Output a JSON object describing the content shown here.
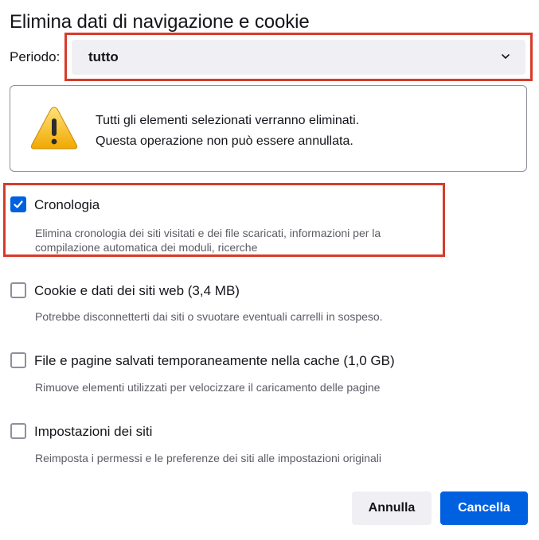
{
  "dialog": {
    "title": "Elimina dati di navigazione e cookie"
  },
  "period": {
    "label": "Periodo:",
    "value": "tutto"
  },
  "warning": {
    "line1": "Tutti gli elementi selezionati verranno eliminati.",
    "line2": "Questa operazione non può essere annullata."
  },
  "options": [
    {
      "label": "Cronologia",
      "checked": true,
      "desc1": "Elimina cronologia dei siti visitati e dei file scaricati, informazioni per la",
      "desc2": "compilazione automatica dei moduli, ricerche"
    },
    {
      "label": "Cookie e dati dei siti web (3,4 MB)",
      "checked": false,
      "desc1": "Potrebbe disconnetterti dai siti o svuotare eventuali carrelli in sospeso."
    },
    {
      "label": "File e pagine salvati temporaneamente nella cache (1,0 GB)",
      "checked": false,
      "desc1": "Rimuove elementi utilizzati per velocizzare il caricamento delle pagine"
    },
    {
      "label": "Impostazioni dei siti",
      "checked": false,
      "desc1": "Reimposta i permessi e le preferenze dei siti alle impostazioni originali"
    }
  ],
  "buttons": {
    "cancel": "Annulla",
    "confirm": "Cancella"
  },
  "colors": {
    "accent": "#0061e0",
    "highlight": "#d73b2a",
    "warning_yellow": "#f5b800"
  },
  "icons": {
    "warning": "warning-triangle-icon",
    "dropdown": "chevron-down-icon",
    "check": "checkmark-icon"
  }
}
